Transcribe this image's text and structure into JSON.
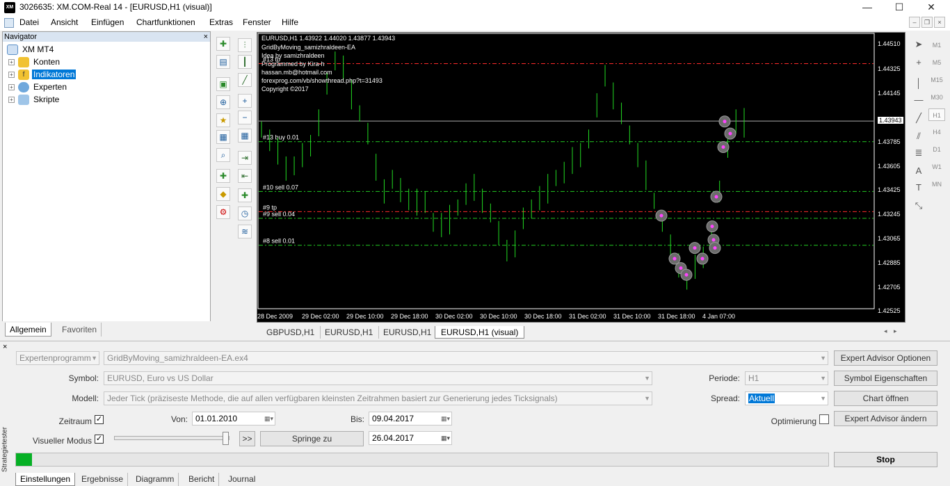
{
  "window": {
    "title": "3026635: XM.COM-Real 14 - [EURUSD,H1 (visual)]",
    "logo": "XM",
    "min": "—",
    "max": "☐",
    "close": "✕"
  },
  "menu": [
    "Datei",
    "Ansicht",
    "Einfügen",
    "Chartfunktionen",
    "Extras",
    "Fenster",
    "Hilfe"
  ],
  "navigator": {
    "title": "Navigator",
    "close": "×",
    "root": "XM MT4",
    "items": [
      "Konten",
      "Indikatoren",
      "Experten",
      "Skripte"
    ],
    "tabs": [
      "Allgemein",
      "Favoriten"
    ]
  },
  "chart": {
    "info": [
      "EURUSD,H1  1.43922 1.44020 1.43877 1.43943",
      "GridByMoving_samizhraldeen-EA",
      "Idea by samizhraldeen",
      "Programmed by Kira-h",
      "hassan.mb@hotmail.com",
      "forexprog.com/vb/showthread.php?t=31493",
      "Copyright ©2017"
    ],
    "orders": [
      {
        "label": "#13 tp",
        "price": 1.4437
      },
      {
        "label": "#13 buy 0.01",
        "price": 1.4379
      },
      {
        "label": "#10 sell 0.07",
        "price": 1.4342
      },
      {
        "label": "#9 tp",
        "price": 1.4327
      },
      {
        "label": "#9 sell 0.04",
        "price": 1.4322
      },
      {
        "label": "#8 sell 0.01",
        "price": 1.4302
      }
    ],
    "price_labels": [
      "1.44510",
      "1.44325",
      "1.44145",
      "1.43943",
      "1.43785",
      "1.43605",
      "1.43425",
      "1.43245",
      "1.43065",
      "1.42885",
      "1.42705",
      "1.42525"
    ],
    "current_price": "1.43943",
    "time_labels": [
      "28 Dec 2009",
      "29 Dec 02:00",
      "29 Dec 10:00",
      "29 Dec 18:00",
      "30 Dec 02:00",
      "30 Dec 10:00",
      "30 Dec 18:00",
      "31 Dec 02:00",
      "31 Dec 10:00",
      "31 Dec 18:00",
      "4 Jan 07:00"
    ],
    "tabs": [
      "GBPUSD,H1",
      "EURUSD,H1",
      "EURUSD,H1",
      "EURUSD,H1 (visual)"
    ]
  },
  "timeframes": [
    "M1",
    "M5",
    "M15",
    "M30",
    "H1",
    "H4",
    "D1",
    "W1",
    "MN"
  ],
  "tester": {
    "side_title": "Strategietester",
    "close": "×",
    "program_type": "Expertenprogramm",
    "program": "GridByMoving_samizhraldeen-EA.ex4",
    "symbol_label": "Symbol:",
    "symbol": "EURUSD, Euro vs US Dollar",
    "model_label": "Modell:",
    "model": "Jeder Tick (präziseste Methode, die auf allen verfügbaren kleinsten Zeitrahmen basiert zur Generierung jedes Ticksignals)",
    "period_label": "Periode:",
    "period": "H1",
    "spread_label": "Spread:",
    "spread": "Aktuell",
    "timerange_label": "Zeitraum",
    "from_label": "Von:",
    "from": "01.01.2010",
    "to_label": "Bis:",
    "to": "09.04.2017",
    "optimization_label": "Optimierung",
    "visual_label": "Visueller Modus",
    "skip_btn": ">>",
    "jump_btn": "Springe zu",
    "jump_date": "26.04.2017",
    "btn_ea_options": "Expert Advisor Optionen",
    "btn_symbol_props": "Symbol Eigenschaften",
    "btn_open_chart": "Chart öffnen",
    "btn_modify_ea": "Expert Advisor ändern",
    "btn_stop": "Stop",
    "progress": 0.02,
    "tabs": [
      "Einstellungen",
      "Ergebnisse",
      "Diagramm",
      "Bericht",
      "Journal"
    ]
  }
}
